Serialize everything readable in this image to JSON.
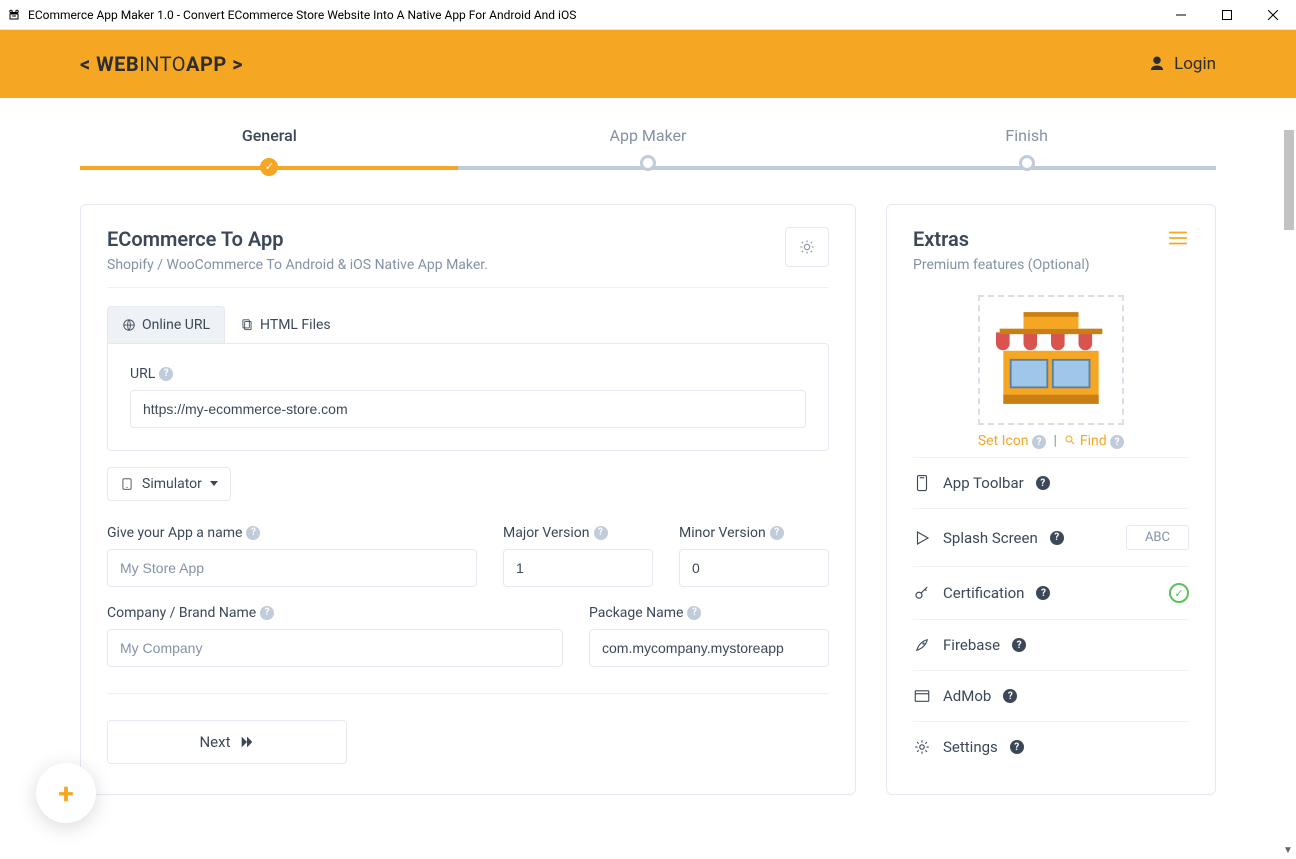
{
  "window": {
    "title": "ECommerce App Maker 1.0 - Convert ECommerce Store Website Into A Native App For Android And iOS"
  },
  "header": {
    "brand_prefix": "< ",
    "brand_bold": "WEB",
    "brand_mid": "INTO",
    "brand_bold2": "APP",
    "brand_suffix": " >",
    "login_label": "Login"
  },
  "stepper": {
    "steps": [
      "General",
      "App Maker",
      "Finish"
    ],
    "active_index": 0
  },
  "main": {
    "title": "ECommerce To App",
    "subtitle": "Shopify / WooCommerce To Android & iOS Native App Maker.",
    "tabs": {
      "online_url": "Online URL",
      "html_files": "HTML Files",
      "active": "online_url"
    },
    "url_label": "URL",
    "url_value": "https://my-ecommerce-store.com",
    "simulator_label": "Simulator",
    "fields": {
      "app_name": {
        "label": "Give your App a name",
        "placeholder": "My Store App",
        "value": ""
      },
      "major_version": {
        "label": "Major Version",
        "value": "1"
      },
      "minor_version": {
        "label": "Minor Version",
        "value": "0"
      },
      "company": {
        "label": "Company / Brand Name",
        "placeholder": "My Company",
        "value": ""
      },
      "package_name": {
        "label": "Package Name",
        "value": "com.mycompany.mystoreapp"
      }
    },
    "next_label": "Next"
  },
  "extras": {
    "title": "Extras",
    "subtitle": "Premium features (Optional)",
    "set_icon": "Set Icon",
    "find": "Find",
    "items": {
      "app_toolbar": "App Toolbar",
      "splash_screen": "Splash Screen",
      "splash_placeholder": "ABC",
      "certification": "Certification",
      "firebase": "Firebase",
      "admob": "AdMob",
      "settings": "Settings"
    }
  },
  "colors": {
    "accent": "#f5a623",
    "muted": "#8492a6",
    "green": "#5cc15c"
  }
}
